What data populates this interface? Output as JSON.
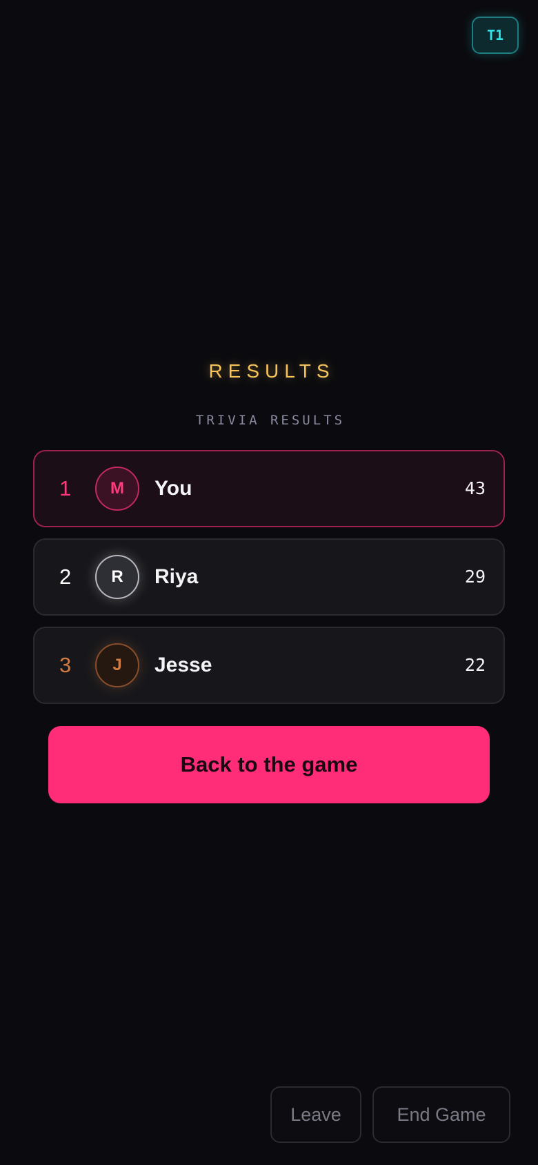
{
  "header": {
    "room_code": "T1"
  },
  "results": {
    "title": "RESULTS",
    "subtitle": "TRIVIA RESULTS",
    "players": [
      {
        "rank": "1",
        "initial": "M",
        "name": "You",
        "score": "43"
      },
      {
        "rank": "2",
        "initial": "R",
        "name": "Riya",
        "score": "29"
      },
      {
        "rank": "3",
        "initial": "J",
        "name": "Jesse",
        "score": "22"
      }
    ]
  },
  "actions": {
    "back_label": "Back to the game",
    "leave_label": "Leave",
    "end_label": "End Game"
  },
  "colors": {
    "accent_pink": "#ff2d78",
    "title_gold": "#f7c35a",
    "room_teal": "#35e0e6",
    "bronze": "#d07a44"
  }
}
